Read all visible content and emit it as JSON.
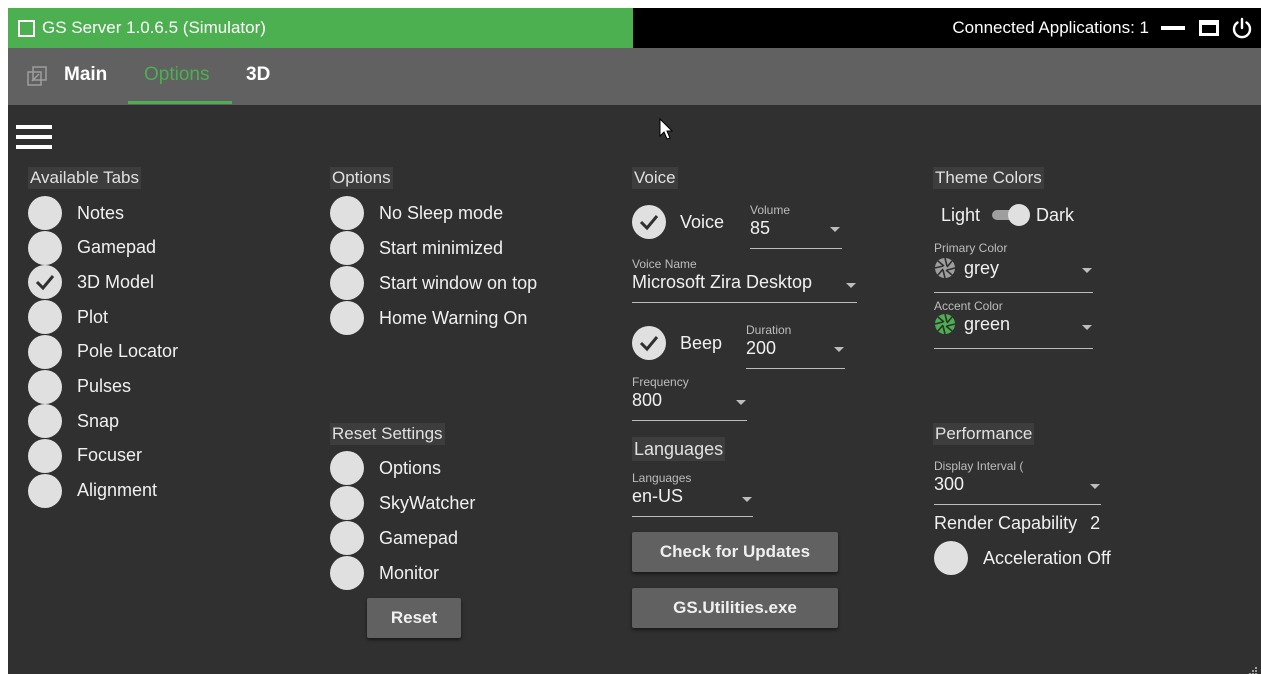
{
  "titlebar": {
    "title": "GS Server 1.0.6.5 (Simulator)",
    "connected_label": "Connected Applications: 1",
    "accent_color": "#4caf50",
    "icons": [
      "checkbox-icon",
      "minimize-icon",
      "maximize-icon",
      "power-icon"
    ]
  },
  "tabs": {
    "main": "Main",
    "options": "Options",
    "three_d": "3D",
    "active": "Options"
  },
  "available_tabs": {
    "header": "Available Tabs",
    "items": [
      {
        "label": "Notes",
        "checked": false
      },
      {
        "label": "Gamepad",
        "checked": false
      },
      {
        "label": "3D Model",
        "checked": true
      },
      {
        "label": "Plot",
        "checked": false
      },
      {
        "label": "Pole Locator",
        "checked": false
      },
      {
        "label": "Pulses",
        "checked": false
      },
      {
        "label": "Snap",
        "checked": false
      },
      {
        "label": "Focuser",
        "checked": false
      },
      {
        "label": "Alignment",
        "checked": false
      }
    ]
  },
  "options": {
    "header": "Options",
    "items": [
      {
        "label": "No Sleep mode",
        "checked": false
      },
      {
        "label": "Start minimized",
        "checked": false
      },
      {
        "label": "Start window on top",
        "checked": false
      },
      {
        "label": "Home Warning On",
        "checked": false
      }
    ]
  },
  "reset_settings": {
    "header": "Reset Settings",
    "items": [
      {
        "label": "Options",
        "checked": false
      },
      {
        "label": "SkyWatcher",
        "checked": false
      },
      {
        "label": "Gamepad",
        "checked": false
      },
      {
        "label": "Monitor",
        "checked": false
      }
    ],
    "reset_button": "Reset"
  },
  "voice": {
    "header": "Voice",
    "voice_label": "Voice",
    "voice_checked": true,
    "volume_caption": "Volume",
    "volume_value": "85",
    "voice_name_caption": "Voice Name",
    "voice_name_value": "Microsoft Zira Desktop",
    "beep_label": "Beep",
    "beep_checked": true,
    "duration_caption": "Duration",
    "duration_value": "200",
    "frequency_caption": "Frequency",
    "frequency_value": "800"
  },
  "languages": {
    "header": "Languages",
    "caption": "Languages",
    "value": "en-US"
  },
  "buttons": {
    "check_updates": "Check for Updates",
    "utilities": "GS.Utilities.exe"
  },
  "theme": {
    "header": "Theme Colors",
    "light_label": "Light",
    "dark_label": "Dark",
    "primary_caption": "Primary Color",
    "primary_value": "grey",
    "primary_swatch": "#9e9e9e",
    "accent_caption": "Accent Color",
    "accent_value": "green",
    "accent_swatch": "#4caf50"
  },
  "performance": {
    "header": "Performance",
    "display_interval_caption": "Display Interval (",
    "display_interval_value": "300",
    "render_label": "Render Capability",
    "render_value": "2",
    "acceleration_label": "Acceleration Off",
    "acceleration_checked": false
  }
}
